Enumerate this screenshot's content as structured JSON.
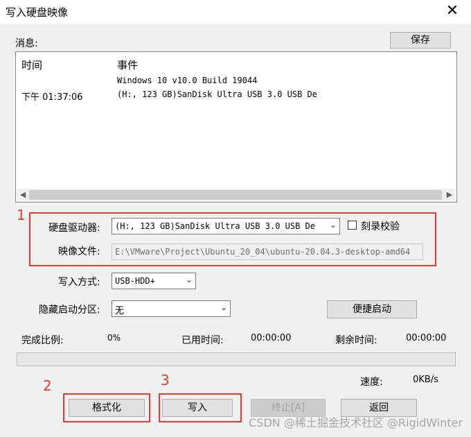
{
  "window": {
    "title": "写入硬盘映像"
  },
  "messages": {
    "label": "消息:",
    "save_label": "保存",
    "columns": {
      "time": "时间",
      "event": "事件"
    },
    "rows": [
      {
        "time": "",
        "event": "Windows 10 v10.0 Build 19044"
      },
      {
        "time": "下午 01:37:06",
        "event": "(H:, 123 GB)SanDisk Ultra USB 3.0 USB De"
      }
    ]
  },
  "form": {
    "drive_label": "硬盘驱动器:",
    "drive_value": "(H:, 123 GB)SanDisk Ultra USB 3.0 USB De",
    "verify_label": "刻录校验",
    "verify_checked": false,
    "image_label": "映像文件:",
    "image_value": "E:\\VMware\\Project\\Ubuntu_20_04\\ubuntu-20.04.3-desktop-amd64",
    "write_method_label": "写入方式:",
    "write_method_value": "USB-HDD+",
    "hidden_partition_label": "隐藏启动分区:",
    "hidden_partition_value": "无",
    "quick_start_label": "便捷启动"
  },
  "status": {
    "done_label": "完成比例:",
    "done_value": "0%",
    "progress": 0,
    "elapsed_label": "已用时间:",
    "elapsed_value": "00:00:00",
    "remaining_label": "剩余时间:",
    "remaining_value": "00:00:00",
    "speed_label": "速度:",
    "speed_value": "0KB/s"
  },
  "buttons": {
    "format": "格式化",
    "write": "写入",
    "abort": "终止[A]",
    "back": "返回"
  },
  "annotations": {
    "one": "1",
    "two": "2",
    "three": "3"
  },
  "watermark": "CSDN @稀土掘金技术社区 @RigidWinter",
  "colors": {
    "annotation": "#e53935",
    "progress_fill": "#06b025"
  }
}
